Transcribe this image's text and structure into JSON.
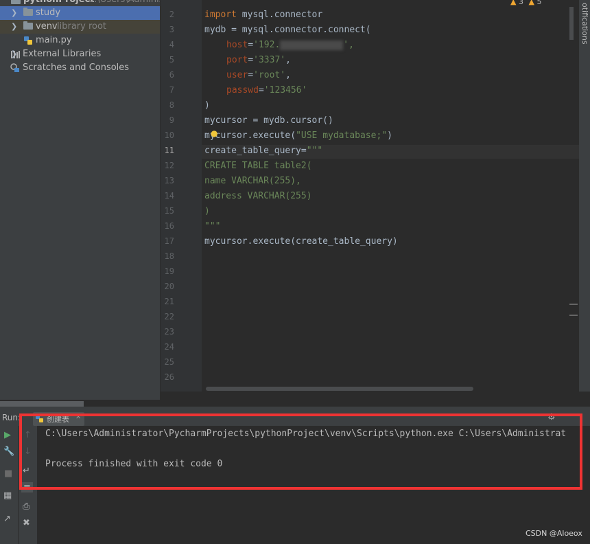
{
  "project": {
    "root_name": "pythonProject",
    "root_path": "C:\\Users\\Administ",
    "items": [
      {
        "label": "study",
        "type": "folder",
        "selected": true
      },
      {
        "label": "venv",
        "type": "folder",
        "hint": "library root"
      },
      {
        "label": "main.py",
        "type": "file"
      },
      {
        "label": "External Libraries",
        "type": "libraries"
      },
      {
        "label": "Scratches and Consoles",
        "type": "scratches"
      }
    ]
  },
  "editor": {
    "inspections": {
      "warnings": "3",
      "weak_warnings": "5"
    },
    "current_line": "11",
    "line_numbers": [
      "2",
      "3",
      "4",
      "5",
      "6",
      "7",
      "8",
      "9",
      "10",
      "11",
      "12",
      "13",
      "14",
      "15",
      "16",
      "17",
      "18",
      "19",
      "20",
      "21",
      "22",
      "23",
      "24",
      "25",
      "26"
    ],
    "code": {
      "l2_kw": "import",
      "l2_rest": " mysql.connector",
      "l3": "mydb = mysql.connector.connect(",
      "l4_param": "host",
      "l4_eq": "=",
      "l4_str_a": "'192.",
      "l4_str_b": "',",
      "l5_param": "port",
      "l5_eq": "=",
      "l5_str": "'3337'",
      "l5_end": ",",
      "l6_param": "user",
      "l6_eq": "=",
      "l6_str": "'root'",
      "l6_end": ",",
      "l7_param": "passwd",
      "l7_eq": "=",
      "l7_str": "'123456'",
      "l8": ")",
      "l9": "mycursor = mydb.cursor()",
      "l10_a": "mycursor.execute(",
      "l10_str": "\"USE mydatabase;\"",
      "l10_b": ")",
      "l11_a": "create_table_query=",
      "l11_str": "\"\"\"",
      "l12": "CREATE TABLE table2(",
      "l13": "name VARCHAR(255),",
      "l14": "address VARCHAR(255)",
      "l15": ")",
      "l16": "\"\"\"",
      "l17": "mycursor.execute(create_table_query)"
    }
  },
  "right_strip": {
    "label": "otifications"
  },
  "run": {
    "label": "Run:",
    "tab_label": "创建表",
    "console": {
      "line1": "C:\\Users\\Administrator\\PycharmProjects\\pythonProject\\venv\\Scripts\\python.exe C:\\Users\\Administrat",
      "line2": "Process finished with exit code 0"
    }
  },
  "watermark": "CSDN @Aloeox",
  "colors": {
    "highlight_box": "#ee3333",
    "keyword": "#cc7832",
    "string": "#6a8759",
    "parameter": "#aa4926",
    "selection": "#4b6eaf"
  }
}
